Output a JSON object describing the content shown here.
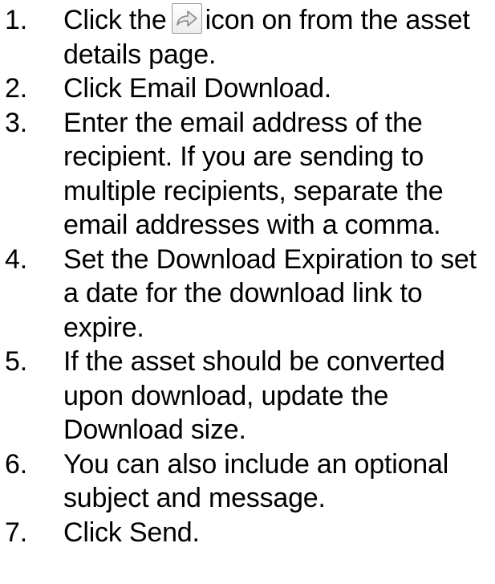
{
  "steps": [
    {
      "number": "1.",
      "before_icon": "Click the",
      "icon": "share-arrow-icon",
      "after_icon": "icon on from the asset details page."
    },
    {
      "number": "2.",
      "text": "Click Email Download."
    },
    {
      "number": "3.",
      "text": "Enter the email address of the recipient. If you are sending to multiple recipients, separate the email addresses with a comma."
    },
    {
      "number": "4.",
      "text": "Set the Download Expiration to set a date for the download link to expire."
    },
    {
      "number": "5.",
      "text": "If the asset should be converted upon download, update the Download size."
    },
    {
      "number": "6.",
      "text": "You can also include an optional subject and message."
    },
    {
      "number": "7.",
      "text": "Click Send."
    }
  ],
  "colors": {
    "text": "#000000",
    "icon_border": "#9a9a9a",
    "icon_arrow_fill": "#e8e8e8",
    "icon_arrow_stroke": "#8a8a8a"
  }
}
